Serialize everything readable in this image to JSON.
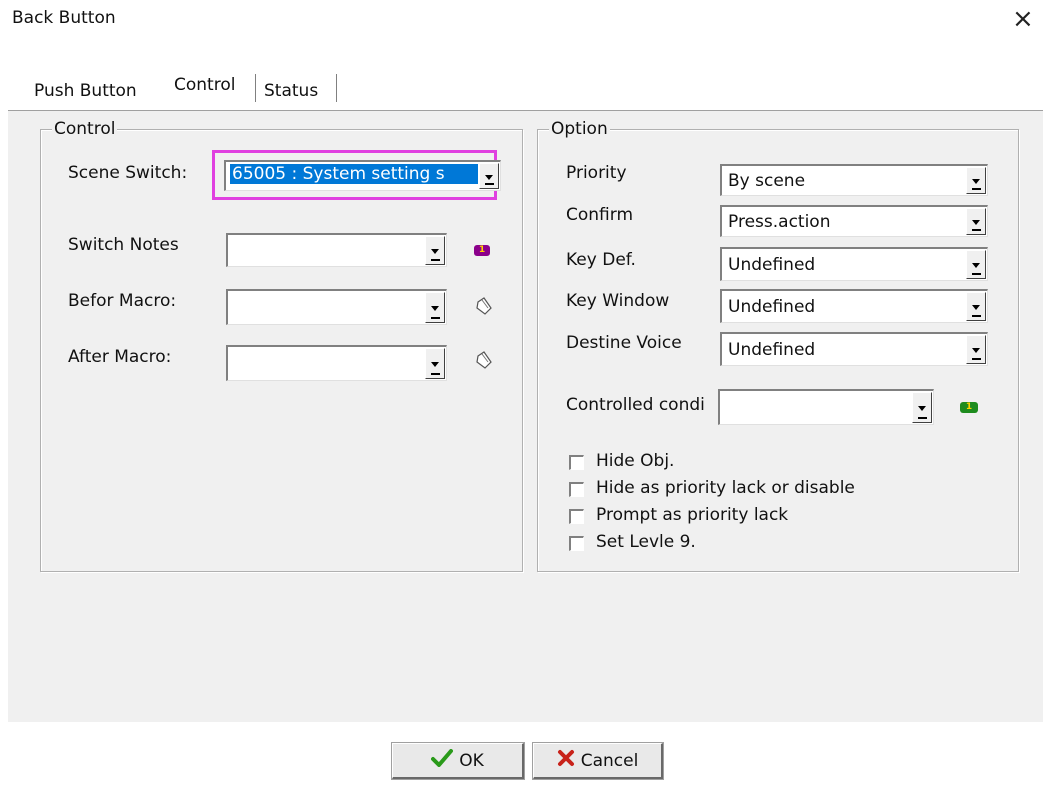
{
  "window": {
    "title": "Back Button",
    "close_icon": "×"
  },
  "tabs": [
    {
      "label": "Push Button"
    },
    {
      "label": "Control"
    },
    {
      "label": "Status"
    }
  ],
  "control_group": {
    "legend": "Control",
    "scene_switch": {
      "label": "Scene Switch:",
      "value": "65005 : System setting s"
    },
    "switch_notes": {
      "label": "Switch Notes",
      "value": ""
    },
    "before_macro": {
      "label": "Befor Macro:",
      "value": ""
    },
    "after_macro": {
      "label": "After Macro:",
      "value": ""
    },
    "notes_badge": "1"
  },
  "option_group": {
    "legend": "Option",
    "priority": {
      "label": "Priority",
      "value": "By scene"
    },
    "confirm": {
      "label": "Confirm",
      "value": "Press.action"
    },
    "key_def": {
      "label": "Key Def.",
      "value": "Undefined"
    },
    "key_window": {
      "label": "Key Window",
      "value": "Undefined"
    },
    "destine_voice": {
      "label": "Destine Voice",
      "value": "Undefined"
    },
    "controlled_condition": {
      "label": "Controlled condi",
      "value": ""
    },
    "condition_badge": "1",
    "checkboxes": [
      {
        "label": "Hide Obj.",
        "checked": false
      },
      {
        "label": "Hide as priority lack or disable",
        "checked": false
      },
      {
        "label": "Prompt as priority lack",
        "checked": false
      },
      {
        "label": "Set Levle 9.",
        "checked": false
      }
    ]
  },
  "buttons": {
    "ok": "OK",
    "cancel": "Cancel"
  },
  "colors": {
    "highlight_box": "#e040e0",
    "selection": "#0078d7",
    "notes_badge": "#8b008b",
    "condition_badge": "#1e8c1e"
  }
}
